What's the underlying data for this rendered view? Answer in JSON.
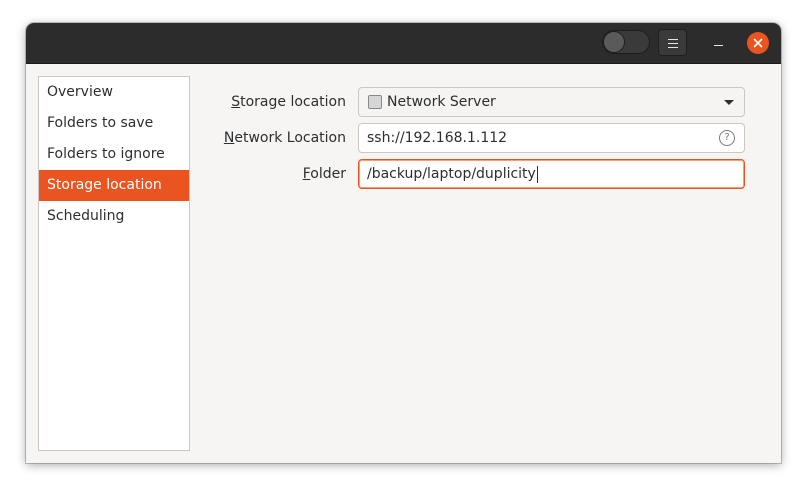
{
  "window": {
    "accent_color": "#e95420",
    "headerbar": {
      "toggle_state": "off",
      "menu_icon": "hamburger-icon",
      "minimize_icon": "minimize-icon",
      "close_icon": "close-icon"
    }
  },
  "sidebar": {
    "items": [
      {
        "label": "Overview",
        "selected": false
      },
      {
        "label": "Folders to save",
        "selected": false
      },
      {
        "label": "Folders to ignore",
        "selected": false
      },
      {
        "label": "Storage location",
        "selected": true
      },
      {
        "label": "Scheduling",
        "selected": false
      }
    ]
  },
  "form": {
    "storage_location": {
      "label_mnemonic": "S",
      "label_rest": "torage location",
      "value": "Network Server",
      "icon": "drive-icon"
    },
    "network_location": {
      "label_mnemonic": "N",
      "label_rest": "etwork Location",
      "value": "ssh://192.168.1.112",
      "help_icon": "help-icon",
      "help_glyph": "?"
    },
    "folder": {
      "label_mnemonic": "F",
      "label_rest": "older",
      "value": "/backup/laptop/duplicity"
    }
  }
}
